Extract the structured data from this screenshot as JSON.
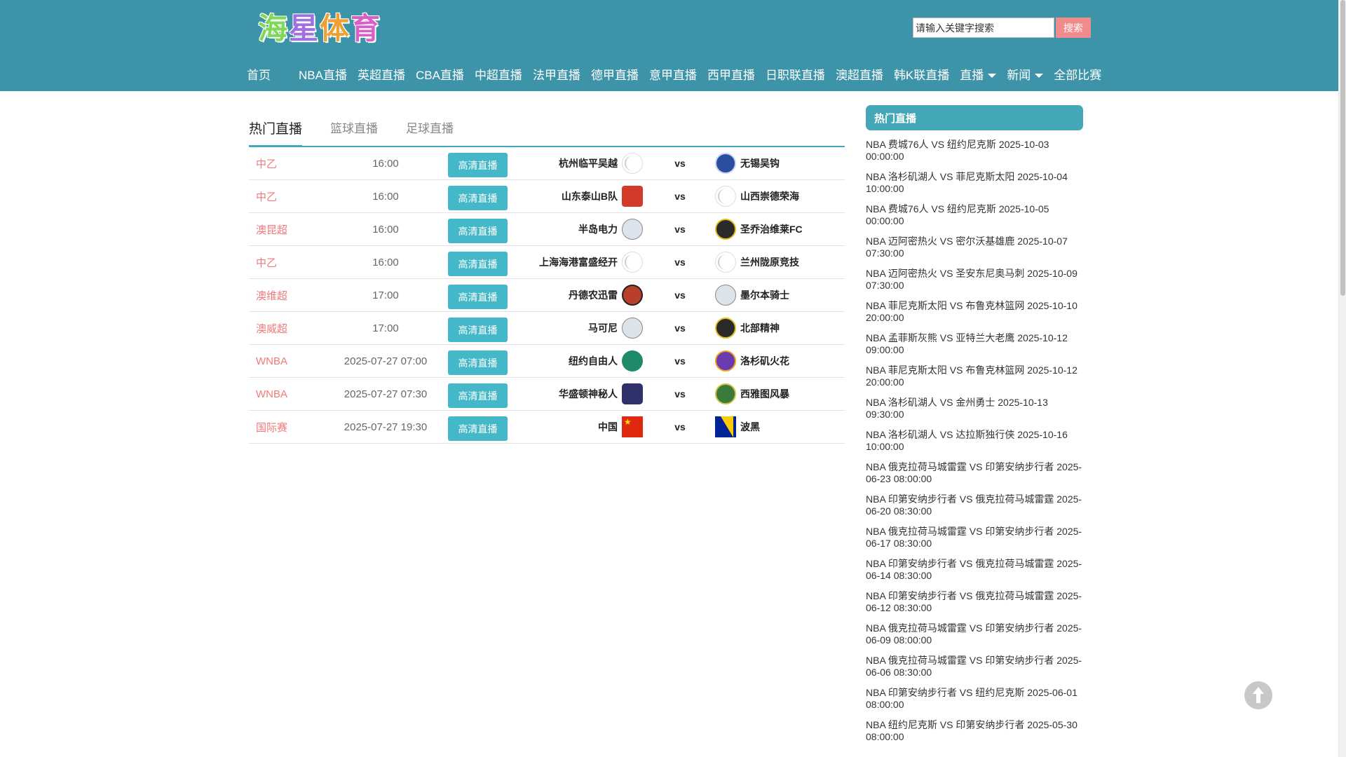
{
  "logo": {
    "chars": [
      "海",
      "星",
      "体",
      "育"
    ]
  },
  "search": {
    "placeholder": "请输入关键字搜索",
    "button": "搜索"
  },
  "nav": {
    "items": [
      {
        "label": "首页"
      },
      {
        "label": "NBA直播"
      },
      {
        "label": "英超直播"
      },
      {
        "label": "CBA直播"
      },
      {
        "label": "中超直播"
      },
      {
        "label": "法甲直播"
      },
      {
        "label": "德甲直播"
      },
      {
        "label": "意甲直播"
      },
      {
        "label": "西甲直播"
      },
      {
        "label": "日职联直播"
      },
      {
        "label": "澳超直播"
      },
      {
        "label": "韩K联直播"
      },
      {
        "label": "直播",
        "dropdown": true
      },
      {
        "label": "新闻",
        "dropdown": true
      },
      {
        "label": "全部比赛"
      }
    ]
  },
  "tabs": [
    "热门直播",
    "篮球直播",
    "足球直播"
  ],
  "live_button": "高清直播",
  "vs_label": "vs",
  "matches": [
    {
      "league": "中乙",
      "time": "16:00",
      "home": "杭州临平吴越",
      "away": "无锡吴钩",
      "home_badge": "blank-icon",
      "away_badge": "blue-crest-icon"
    },
    {
      "league": "中乙",
      "time": "16:00",
      "home": "山东泰山B队",
      "away": "山西崇德荣海",
      "home_badge": "red-crest-icon",
      "away_badge": "blank-icon"
    },
    {
      "league": "澳昆超",
      "time": "16:00",
      "home": "半岛电力",
      "away": "圣乔治维莱FC",
      "home_badge": "grey-crest-icon",
      "away_badge": "gold-crest-icon"
    },
    {
      "league": "中乙",
      "time": "16:00",
      "home": "上海海港富盛经开",
      "away": "兰州陇原竞技",
      "home_badge": "blank-icon",
      "away_badge": "blank-icon"
    },
    {
      "league": "澳维超",
      "time": "17:00",
      "home": "丹德农迅雷",
      "away": "墨尔本骑士",
      "home_badge": "orange-crest-icon",
      "away_badge": "grey-crest-icon"
    },
    {
      "league": "澳威超",
      "time": "17:00",
      "home": "马可尼",
      "away": "北部精神",
      "home_badge": "grey-crest-icon",
      "away_badge": "gold-crest-icon"
    },
    {
      "league": "WNBA",
      "time": "2025-07-27 07:00",
      "home": "纽约自由人",
      "away": "洛杉矶火花",
      "home_badge": "green-crest-icon",
      "away_badge": "purple-crest-icon"
    },
    {
      "league": "WNBA",
      "time": "2025-07-27 07:30",
      "home": "华盛顿神秘人",
      "away": "西雅图风暴",
      "home_badge": "navy-crest-icon",
      "away_badge": "teal-crest-icon"
    },
    {
      "league": "国际赛",
      "time": "2025-07-27 19:30",
      "home": "中国",
      "away": "波黑",
      "home_badge": "flag-china-icon",
      "away_badge": "flag-bosnia-icon"
    }
  ],
  "sidebar": {
    "title": "热门直播",
    "items": [
      "NBA 费城76人 VS 纽约尼克斯 2025-10-03 00:00:00",
      "NBA 洛杉矶湖人 VS 菲尼克斯太阳 2025-10-04 10:00:00",
      "NBA 费城76人 VS 纽约尼克斯 2025-10-05 00:00:00",
      "NBA 迈阿密热火 VS 密尔沃基雄鹿 2025-10-07 07:30:00",
      "NBA 迈阿密热火 VS 圣安东尼奥马刺 2025-10-09 07:30:00",
      "NBA 菲尼克斯太阳 VS 布鲁克林篮网 2025-10-10 20:00:00",
      "NBA 孟菲斯灰熊 VS 亚特兰大老鹰 2025-10-12 09:00:00",
      "NBA 菲尼克斯太阳 VS 布鲁克林篮网 2025-10-12 20:00:00",
      "NBA 洛杉矶湖人 VS 金州勇士 2025-10-13 09:30:00",
      "NBA 洛杉矶湖人 VS 达拉斯独行侠 2025-10-16 10:00:00",
      "NBA 俄克拉荷马城雷霆 VS 印第安纳步行者 2025-06-23 08:00:00",
      "NBA 印第安纳步行者 VS 俄克拉荷马城雷霆 2025-06-20 08:30:00",
      "NBA 俄克拉荷马城雷霆 VS 印第安纳步行者 2025-06-17 08:30:00",
      "NBA 印第安纳步行者 VS 俄克拉荷马城雷霆 2025-06-14 08:30:00",
      "NBA 印第安纳步行者 VS 俄克拉荷马城雷霆 2025-06-12 08:30:00",
      "NBA 俄克拉荷马城雷霆 VS 印第安纳步行者 2025-06-09 08:00:00",
      "NBA 俄克拉荷马城雷霆 VS 印第安纳步行者 2025-06-06 08:30:00",
      "NBA 印第安纳步行者 VS 纽约尼克斯 2025-06-01 08:00:00",
      "NBA 纽约尼克斯 VS 印第安纳步行者 2025-05-30 08:00:00"
    ]
  },
  "colors": {
    "header": "#3d94a8",
    "accent": "#44b8c8",
    "league": "#ef7a7a",
    "search_button": "#f28b8b"
  }
}
